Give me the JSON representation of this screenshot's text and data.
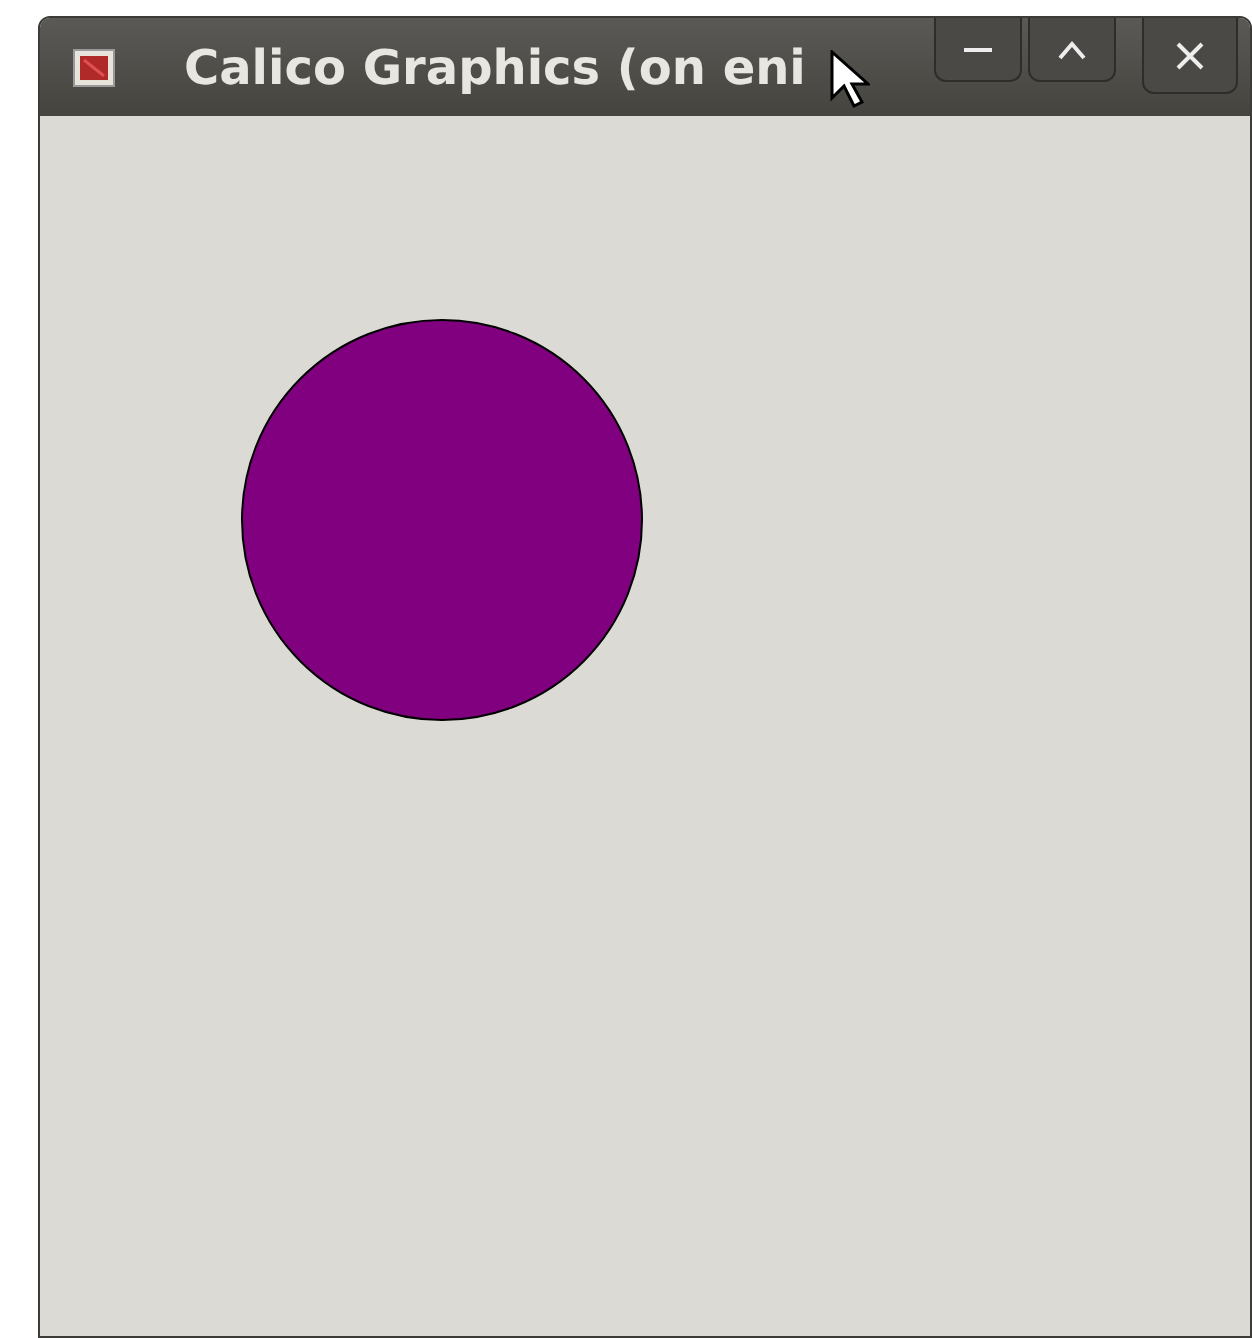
{
  "window": {
    "title": "Calico Graphics (on eni"
  },
  "canvas": {
    "shapes": [
      {
        "kind": "circle",
        "color": "#800080"
      }
    ]
  }
}
